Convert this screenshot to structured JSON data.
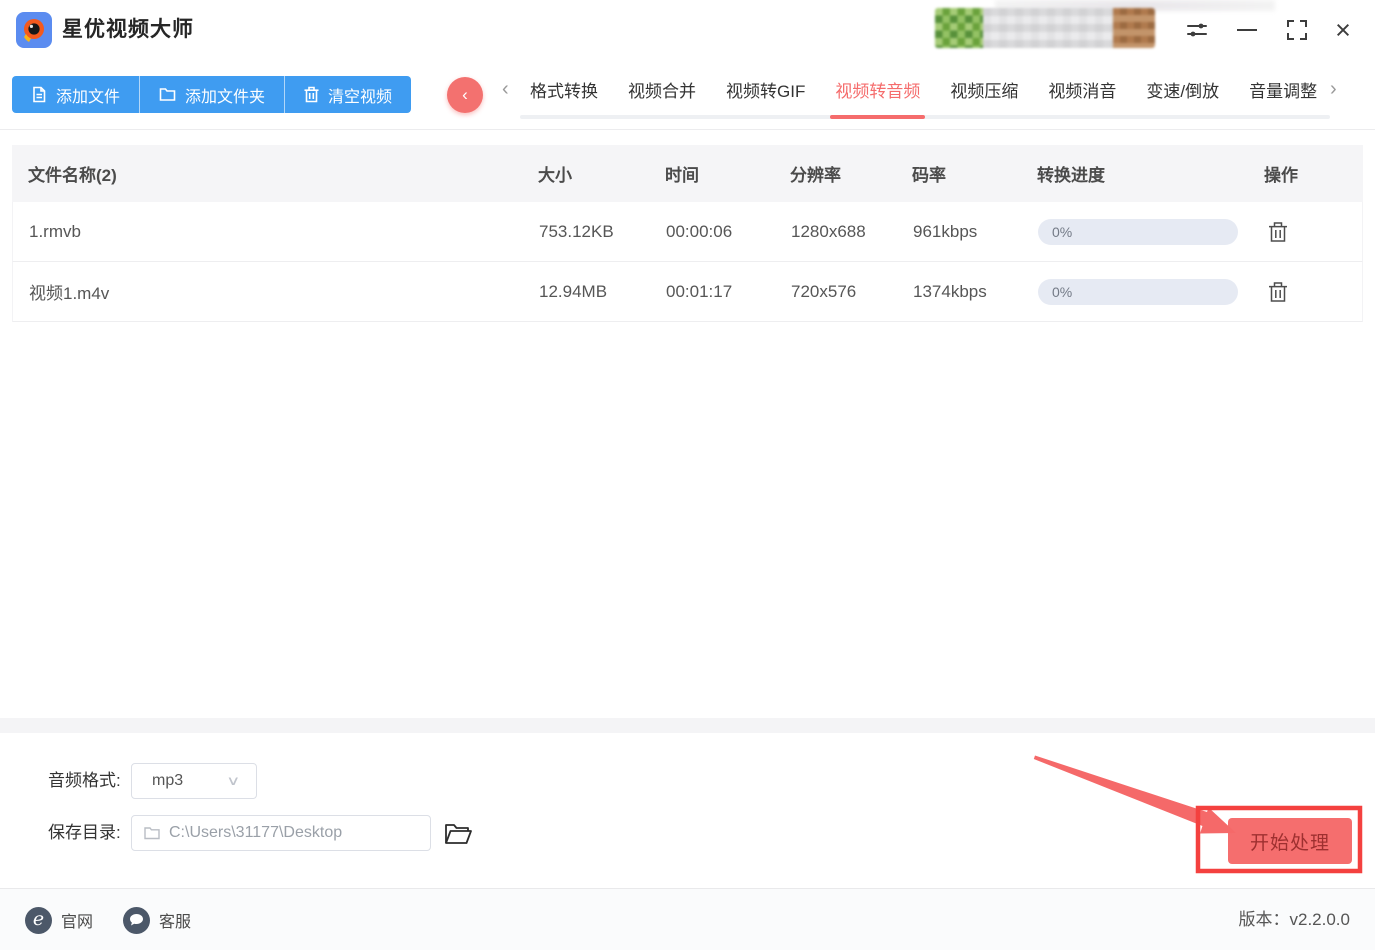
{
  "app": {
    "title": "星优视频大师",
    "accent_blue": "#3f9cf1",
    "accent_red": "#f56c6c",
    "annotation_red": "#f4413f"
  },
  "titlebar": {
    "icons": [
      "sliders-icon",
      "minimize-icon",
      "maximize-icon",
      "close-icon"
    ],
    "close_glyph": "×"
  },
  "toolbar": {
    "add_file": "添加文件",
    "add_folder": "添加文件夹",
    "clear_videos": "清空视频"
  },
  "tabs": {
    "back_glyph": "‹",
    "scroll_left_glyph": "‹",
    "scroll_right_glyph": "›",
    "items": [
      {
        "label": "格式转换",
        "active": false
      },
      {
        "label": "视频合并",
        "active": false
      },
      {
        "label": "视频转GIF",
        "active": false
      },
      {
        "label": "视频转音频",
        "active": true
      },
      {
        "label": "视频压缩",
        "active": false
      },
      {
        "label": "视频消音",
        "active": false
      },
      {
        "label": "变速/倒放",
        "active": false
      },
      {
        "label": "音量调整",
        "active": false
      }
    ]
  },
  "table": {
    "headers": {
      "name": "文件名称(2)",
      "size": "大小",
      "duration": "时间",
      "resolution": "分辨率",
      "bitrate": "码率",
      "progress": "转换进度",
      "action": "操作"
    },
    "rows": [
      {
        "name": "1.rmvb",
        "size": "753.12KB",
        "duration": "00:00:06",
        "resolution": "1280x688",
        "bitrate": "961kbps",
        "progress": "0%"
      },
      {
        "name": "视频1.m4v",
        "size": "12.94MB",
        "duration": "00:01:17",
        "resolution": "720x576",
        "bitrate": "1374kbps",
        "progress": "0%"
      }
    ]
  },
  "settings": {
    "audio_format_label": "音频格式:",
    "audio_format_value": "mp3",
    "select_caret": "∨",
    "save_dir_label": "保存目录:",
    "save_dir_value": "C:\\Users\\31177\\Desktop",
    "start_button": "开始处理"
  },
  "footer": {
    "website": "官网",
    "support": "客服",
    "version": "版本：v2.2.0.0"
  }
}
